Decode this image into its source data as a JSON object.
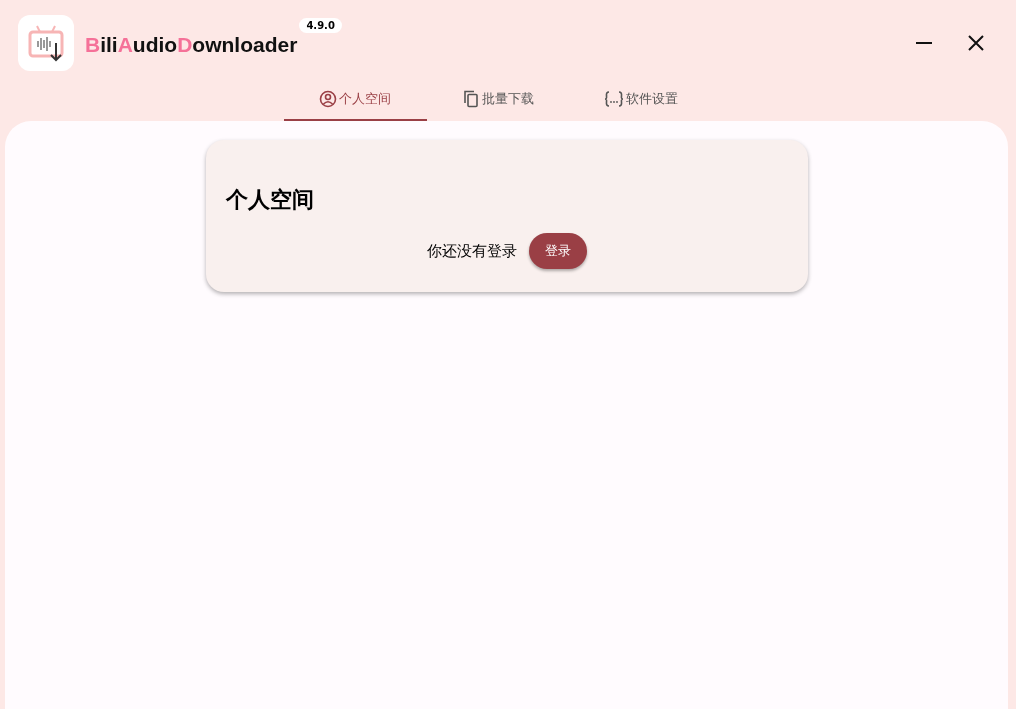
{
  "app": {
    "title_parts": [
      {
        "text": "B",
        "accent": true
      },
      {
        "text": "ili",
        "accent": false
      },
      {
        "text": "A",
        "accent": true
      },
      {
        "text": "udio",
        "accent": false
      },
      {
        "text": "D",
        "accent": true
      },
      {
        "text": "ownloader",
        "accent": false
      }
    ],
    "version": "4.9.0"
  },
  "tabs": [
    {
      "label": "个人空间",
      "kind": "user",
      "selected": true
    },
    {
      "label": "批量下载",
      "kind": "copy",
      "selected": false
    },
    {
      "label": "软件设置",
      "kind": "braces",
      "selected": false
    }
  ],
  "card": {
    "title": "个人空间",
    "message": "你还没有登录",
    "button": "登录"
  }
}
